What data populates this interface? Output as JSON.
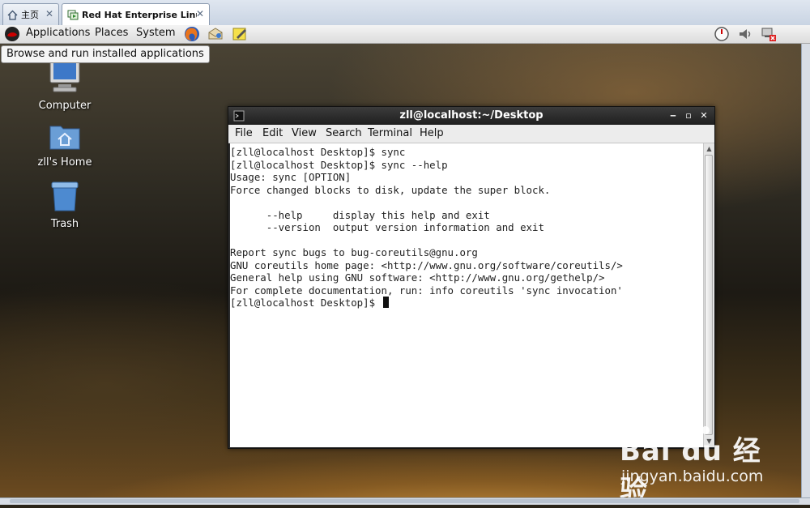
{
  "tabs": [
    {
      "label": "主页",
      "icon": "home-icon"
    },
    {
      "label": "Red Hat Enterprise Linux ...",
      "icon": "vm-icon"
    }
  ],
  "panel": {
    "menus": [
      "Applications",
      "Places",
      "System"
    ],
    "launchers": [
      "firefox-icon",
      "mail-icon",
      "notes-icon"
    ],
    "tray": [
      "gauge-icon",
      "volume-icon",
      "network-disconnected-icon"
    ]
  },
  "tooltip": "Browse and run installed applications",
  "desktop": {
    "icons": [
      {
        "label": "Computer",
        "icon": "computer-icon"
      },
      {
        "label": "zll's Home",
        "icon": "home-folder-icon"
      },
      {
        "label": "Trash",
        "icon": "trash-icon"
      }
    ]
  },
  "terminal": {
    "title": "zll@localhost:~/Desktop",
    "menu": [
      "File",
      "Edit",
      "View",
      "Search",
      "Terminal",
      "Help"
    ],
    "lines": [
      "[zll@localhost Desktop]$ sync",
      "[zll@localhost Desktop]$ sync --help",
      "Usage: sync [OPTION]",
      "Force changed blocks to disk, update the super block.",
      "",
      "      --help     display this help and exit",
      "      --version  output version information and exit",
      "",
      "Report sync bugs to bug-coreutils@gnu.org",
      "GNU coreutils home page: <http://www.gnu.org/software/coreutils/>",
      "General help using GNU software: <http://www.gnu.org/gethelp/>",
      "For complete documentation, run: info coreutils 'sync invocation'"
    ],
    "prompt": "[zll@localhost Desktop]$ "
  },
  "watermark": {
    "brand": "Bai du 经验",
    "url": "jingyan.baidu.com"
  }
}
